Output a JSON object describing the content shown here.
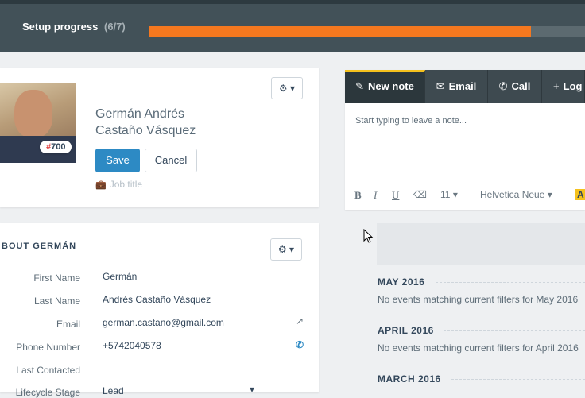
{
  "setup": {
    "title": "Setup progress",
    "count": "(6/7)",
    "progress_fraction": 0.857
  },
  "profile": {
    "badge_hash": "#",
    "badge_number": "700",
    "first_name_line": "Germán Andrés",
    "last_name_line": "Castaño Vásquez",
    "save_label": "Save",
    "cancel_label": "Cancel",
    "job_title_placeholder": "Job title",
    "settings_icon": "gear-icon"
  },
  "about": {
    "title": "BOUT GERMÁN",
    "fields": [
      {
        "label": "First Name",
        "value": "Germán"
      },
      {
        "label": "Last Name",
        "value": "Andrés Castaño Vásquez"
      },
      {
        "label": "Email",
        "value": "german.castano@gmail.com"
      },
      {
        "label": "Phone Number",
        "value": "+5742040578"
      },
      {
        "label": "Last Contacted",
        "value": ""
      },
      {
        "label": "Lifecycle Stage",
        "value": "Lead"
      }
    ]
  },
  "editor": {
    "tabs": [
      {
        "label": "New note",
        "icon": "edit-icon"
      },
      {
        "label": "Email",
        "icon": "envelope-icon"
      },
      {
        "label": "Call",
        "icon": "phone-icon"
      },
      {
        "label": "Log",
        "icon": "plus-icon"
      }
    ],
    "placeholder": "Start typing to leave a note...",
    "toolbar": {
      "bold": "B",
      "italic": "I",
      "underline": "U",
      "font_size": "11",
      "font_family": "Helvetica Neue",
      "highlight": "A"
    }
  },
  "timeline": {
    "months": [
      {
        "name": "MAY 2016",
        "message": "No events matching current filters for May 2016"
      },
      {
        "name": "APRIL 2016",
        "message": "No events matching current filters for April 2016"
      },
      {
        "name": "MARCH 2016",
        "message": ""
      }
    ]
  },
  "colors": {
    "accent_orange": "#f5781f",
    "primary_blue": "#2d8ac4",
    "tab_highlight": "#f5c11d"
  }
}
